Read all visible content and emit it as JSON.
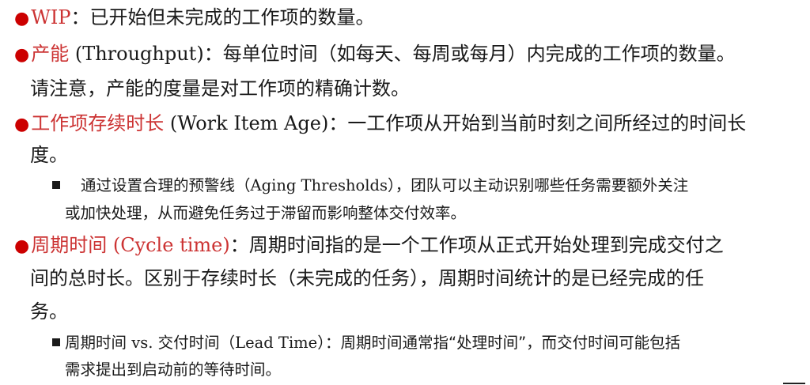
{
  "items": [
    {
      "term": "WIP",
      "sep": "：",
      "desc": "已开始但未完成的工作项的数量。"
    },
    {
      "term": "产能",
      "term_en": " (Throughput)",
      "sep": "：",
      "desc_line1": "每单位时间（如每天、每周或每月）内完成的工作项的数量。",
      "desc_line2": "请注意，产能的度量是对工作项的精确计数。"
    },
    {
      "term": "工作项存续时长",
      "term_en": " (Work Item Age)",
      "sep": "：",
      "desc_line1": "一工作项从开始到当前时刻之间所经过的时间长",
      "desc_line2": "度。",
      "sub": {
        "pre": "通过设置合理的预警线（",
        "en": "Aging Thresholds",
        "post": "），团队可以主动识别哪些任务需要额外关注",
        "line2": "或加快处理，从而避免任务过于滞留而影响整体交付效率。"
      }
    },
    {
      "term": "周期时间",
      "term_en": " (Cycle time)",
      "sep": "：",
      "desc_line1": "周期时间指的是一个工作项从正式开始处理到完成交付之",
      "desc_line2": "间的总时长。区别于存续时长（未完成的任务），周期时间统计的是已经完成的任",
      "desc_line3": "务。",
      "sub": {
        "pre": "周期时间 ",
        "en1": "vs.",
        "mid": " 交付时间（",
        "en2": "Lead Time",
        "post": "）：周期时间通常指“处理时间”，而交付时间可能包括",
        "line2": "需求提出到启动前的等待时间。"
      }
    }
  ],
  "bullet_char": "●",
  "colors": {
    "term": "#cc3333",
    "bullet": "#cc0000",
    "text": "#1a1a1a"
  }
}
